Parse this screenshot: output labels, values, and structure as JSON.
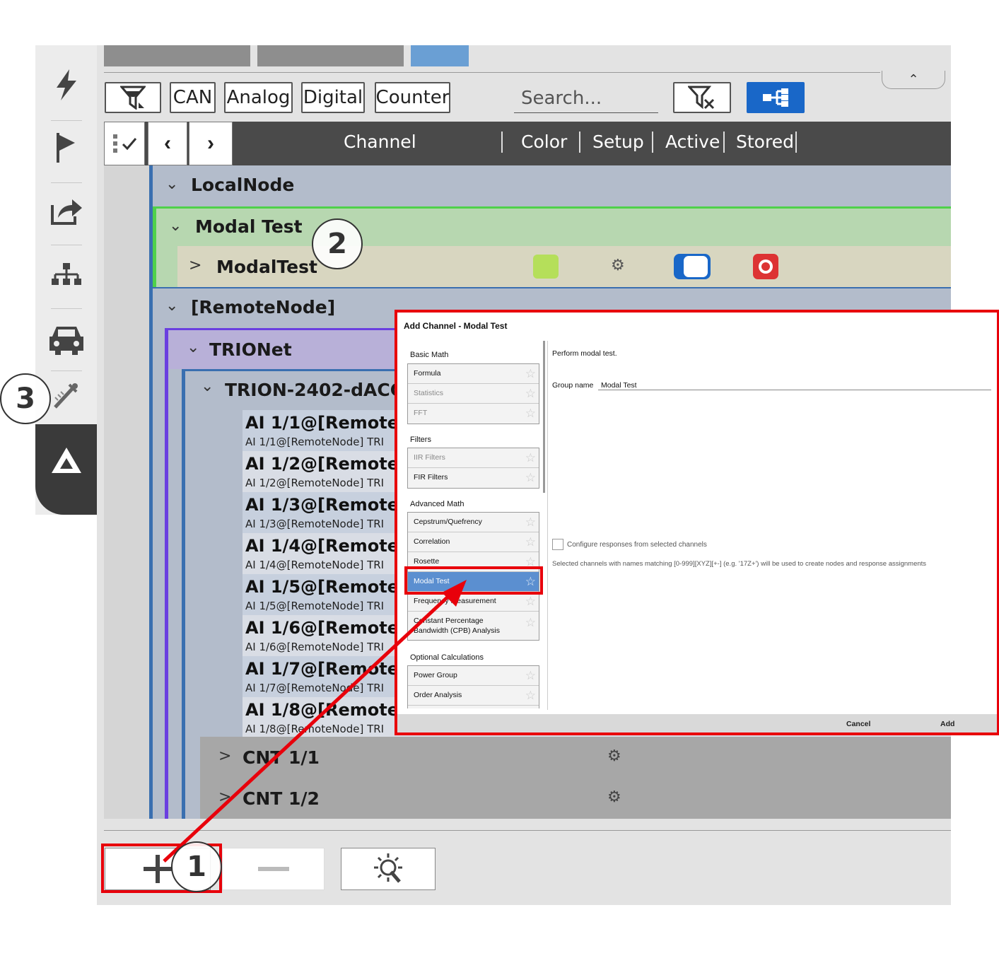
{
  "toolbar": {
    "filter_can": "CAN",
    "filter_analog": "Analog",
    "filter_digital": "Digital",
    "filter_counter": "Counter",
    "search_placeholder": "Search..."
  },
  "table": {
    "columns": [
      "Channel",
      "Color",
      "Setup",
      "Active",
      "Stored"
    ]
  },
  "tree": {
    "local_node": "LocalNode",
    "modal_test_group": "Modal Test",
    "modal_test_channel": "ModalTest",
    "remote_node": "[RemoteNode]",
    "trionet": "TRIONet",
    "trion_device": "TRION-2402-dACC-8-",
    "ai_channels": [
      {
        "name": "AI 1/1@[RemoteN",
        "sub": "AI 1/1@[RemoteNode]   TRI"
      },
      {
        "name": "AI 1/2@[RemoteN",
        "sub": "AI 1/2@[RemoteNode]   TRI"
      },
      {
        "name": "AI 1/3@[RemoteN",
        "sub": "AI 1/3@[RemoteNode]   TRI"
      },
      {
        "name": "AI 1/4@[RemoteN",
        "sub": "AI 1/4@[RemoteNode]   TRI"
      },
      {
        "name": "AI 1/5@[RemoteN",
        "sub": "AI 1/5@[RemoteNode]   TRI"
      },
      {
        "name": "AI 1/6@[RemoteN",
        "sub": "AI 1/6@[RemoteNode]   TRI"
      },
      {
        "name": "AI 1/7@[RemoteN",
        "sub": "AI 1/7@[RemoteNode]   TRI"
      },
      {
        "name": "AI 1/8@[RemoteN",
        "sub": "AI 1/8@[RemoteNode]   TRI"
      }
    ],
    "cnt_1": "CNT 1/1",
    "cnt_2": "CNT 1/2"
  },
  "dialog": {
    "title": "Add Channel - Modal Test",
    "description": "Perform modal test.",
    "group_name_label": "Group name",
    "group_name_value": "Modal Test",
    "configure_label": "Configure responses from selected channels",
    "note": "Selected channels with names matching [0-999][XYZ][+-] (e.g. '17Z+') will be used to create nodes and response assignments",
    "cancel": "Cancel",
    "add": "Add",
    "categories": [
      {
        "title": "Basic Math",
        "items": [
          {
            "label": "Formula",
            "dim": false
          },
          {
            "label": "Statistics",
            "dim": true
          },
          {
            "label": "FFT",
            "dim": true
          }
        ]
      },
      {
        "title": "Filters",
        "items": [
          {
            "label": "IIR Filters",
            "dim": true
          },
          {
            "label": "FIR Filters",
            "dim": false
          }
        ]
      },
      {
        "title": "Advanced Math",
        "items": [
          {
            "label": "Cepstrum/Quefrency",
            "dim": false
          },
          {
            "label": "Correlation",
            "dim": false
          },
          {
            "label": "Rosette",
            "dim": false
          },
          {
            "label": "Modal Test",
            "dim": false,
            "selected": true
          },
          {
            "label": "Frequency Measurement",
            "dim": false
          },
          {
            "label": "Constant Percentage Bandwidth (CPB) Analysis",
            "dim": false
          }
        ]
      },
      {
        "title": "Optional Calculations",
        "items": [
          {
            "label": "Power Group",
            "dim": false
          },
          {
            "label": "Order Analysis",
            "dim": false
          }
        ]
      }
    ]
  },
  "callouts": {
    "one": "1",
    "two": "2",
    "three": "3"
  },
  "colors": {
    "highlight_red": "#e8000b",
    "selected_blue": "#5b8fd0",
    "modal_group_green": "#b7d7b0",
    "trionet_purple": "#b8b0d8"
  }
}
